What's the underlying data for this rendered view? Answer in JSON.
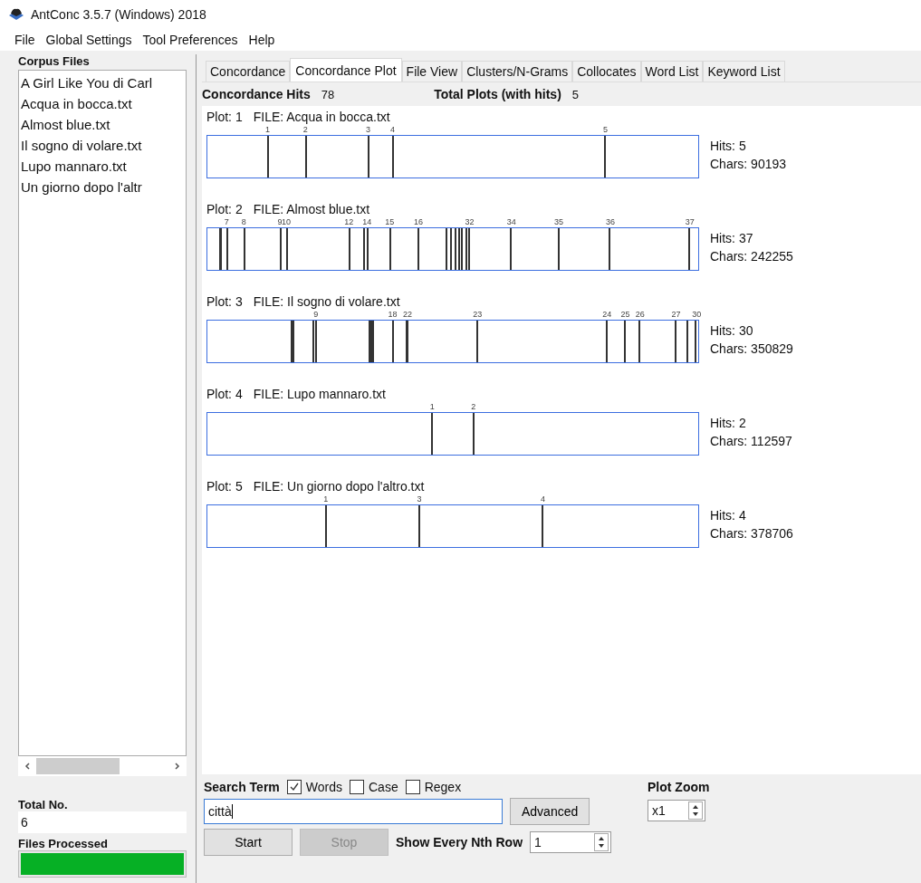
{
  "window": {
    "title": "AntConc 3.5.7 (Windows) 2018"
  },
  "menu": [
    "File",
    "Global Settings",
    "Tool Preferences",
    "Help"
  ],
  "corpus_files": {
    "title": "Corpus Files",
    "files": [
      "A Girl Like You di Carl",
      "Acqua in bocca.txt",
      "Almost blue.txt",
      "Il sogno di volare.txt",
      "Lupo mannaro.txt",
      "Un giorno dopo l'altr"
    ]
  },
  "total_no": {
    "label": "Total No.",
    "value": "6"
  },
  "files_processed": {
    "label": "Files Processed",
    "level": 1
  },
  "tabs": [
    {
      "label": "Concordance",
      "selected": false
    },
    {
      "label": "Concordance Plot",
      "selected": true
    },
    {
      "label": "File View",
      "selected": false
    },
    {
      "label": "Clusters/N-Grams",
      "selected": false
    },
    {
      "label": "Collocates",
      "selected": false
    },
    {
      "label": "Word List",
      "selected": false
    },
    {
      "label": "Keyword List",
      "selected": false
    }
  ],
  "summary": {
    "hits_label": "Concordance Hits",
    "hits_value": "78",
    "plots_label": "Total Plots (with hits)",
    "plots_value": "5"
  },
  "plots": [
    {
      "plot_label": "Plot: 1",
      "file_label": "FILE: Acqua in bocca.txt",
      "hits_text": "Hits: 5",
      "chars_text": "Chars: 90193",
      "hits": [
        {
          "label": "1",
          "level": 0.124
        },
        {
          "label": "2",
          "level": 0.201
        },
        {
          "label": "3",
          "level": 0.328
        },
        {
          "label": "4",
          "level": 0.378
        },
        {
          "label": "5",
          "level": 0.81
        }
      ]
    },
    {
      "plot_label": "Plot: 2",
      "file_label": "FILE: Almost blue.txt",
      "hits_text": "Hits: 37",
      "chars_text": "Chars: 242255",
      "hits": [
        {
          "level": 0.025
        },
        {
          "level": 0.028
        },
        {
          "label": "7",
          "level": 0.041
        },
        {
          "label": "8",
          "level": 0.076
        },
        {
          "label": "9",
          "level": 0.149
        },
        {
          "label": "10",
          "level": 0.162
        },
        {
          "label": "12",
          "level": 0.289
        },
        {
          "level": 0.319
        },
        {
          "label": "14",
          "level": 0.326
        },
        {
          "label": "15",
          "level": 0.372
        },
        {
          "label": "16",
          "level": 0.43
        },
        {
          "level": 0.488
        },
        {
          "level": 0.497
        },
        {
          "level": 0.505
        },
        {
          "level": 0.513
        },
        {
          "level": 0.519
        },
        {
          "level": 0.528
        },
        {
          "label": "32",
          "level": 0.534
        },
        {
          "label": "34",
          "level": 0.619
        },
        {
          "label": "35",
          "level": 0.715
        },
        {
          "label": "36",
          "level": 0.82
        },
        {
          "label": "37",
          "level": 0.981
        }
      ]
    },
    {
      "plot_label": "Plot: 3",
      "file_label": "FILE: Il sogno di volare.txt",
      "hits_text": "Hits: 30",
      "chars_text": "Chars: 350829",
      "hits": [
        {
          "level": 0.172
        },
        {
          "level": 0.176
        },
        {
          "level": 0.216
        },
        {
          "label": "9",
          "level": 0.222
        },
        {
          "level": 0.33
        },
        {
          "level": 0.334
        },
        {
          "level": 0.338
        },
        {
          "label": "18",
          "level": 0.378
        },
        {
          "level": 0.405
        },
        {
          "label": "22",
          "level": 0.408
        },
        {
          "label": "23",
          "level": 0.55
        },
        {
          "label": "24",
          "level": 0.813
        },
        {
          "label": "25",
          "level": 0.85
        },
        {
          "label": "26",
          "level": 0.88
        },
        {
          "label": "27",
          "level": 0.953
        },
        {
          "level": 0.978
        },
        {
          "label": "30",
          "level": 0.995
        }
      ]
    },
    {
      "plot_label": "Plot: 4",
      "file_label": "FILE: Lupo mannaro.txt",
      "hits_text": "Hits: 2",
      "chars_text": "Chars: 112597",
      "hits": [
        {
          "label": "1",
          "level": 0.458
        },
        {
          "label": "2",
          "level": 0.542
        }
      ]
    },
    {
      "plot_label": "Plot: 5",
      "file_label": "FILE: Un giorno dopo l'altro.txt",
      "hits_text": "Hits: 4",
      "chars_text": "Chars: 378706",
      "hits": [
        {
          "label": "1",
          "level": 0.242
        },
        {
          "label": "3",
          "level": 0.432
        },
        {
          "label": "4",
          "level": 0.683
        }
      ]
    }
  ],
  "search": {
    "label": "Search Term",
    "options": [
      {
        "label": "Words",
        "checked": true
      },
      {
        "label": "Case",
        "checked": false
      },
      {
        "label": "Regex",
        "checked": false
      }
    ],
    "value": "città",
    "advanced": "Advanced",
    "start": "Start",
    "stop": {
      "label": "Stop",
      "disabled": true
    },
    "nth_label": "Show Every Nth Row",
    "nth_value": "1",
    "zoom_label": "Plot Zoom",
    "zoom_value": "x1"
  }
}
